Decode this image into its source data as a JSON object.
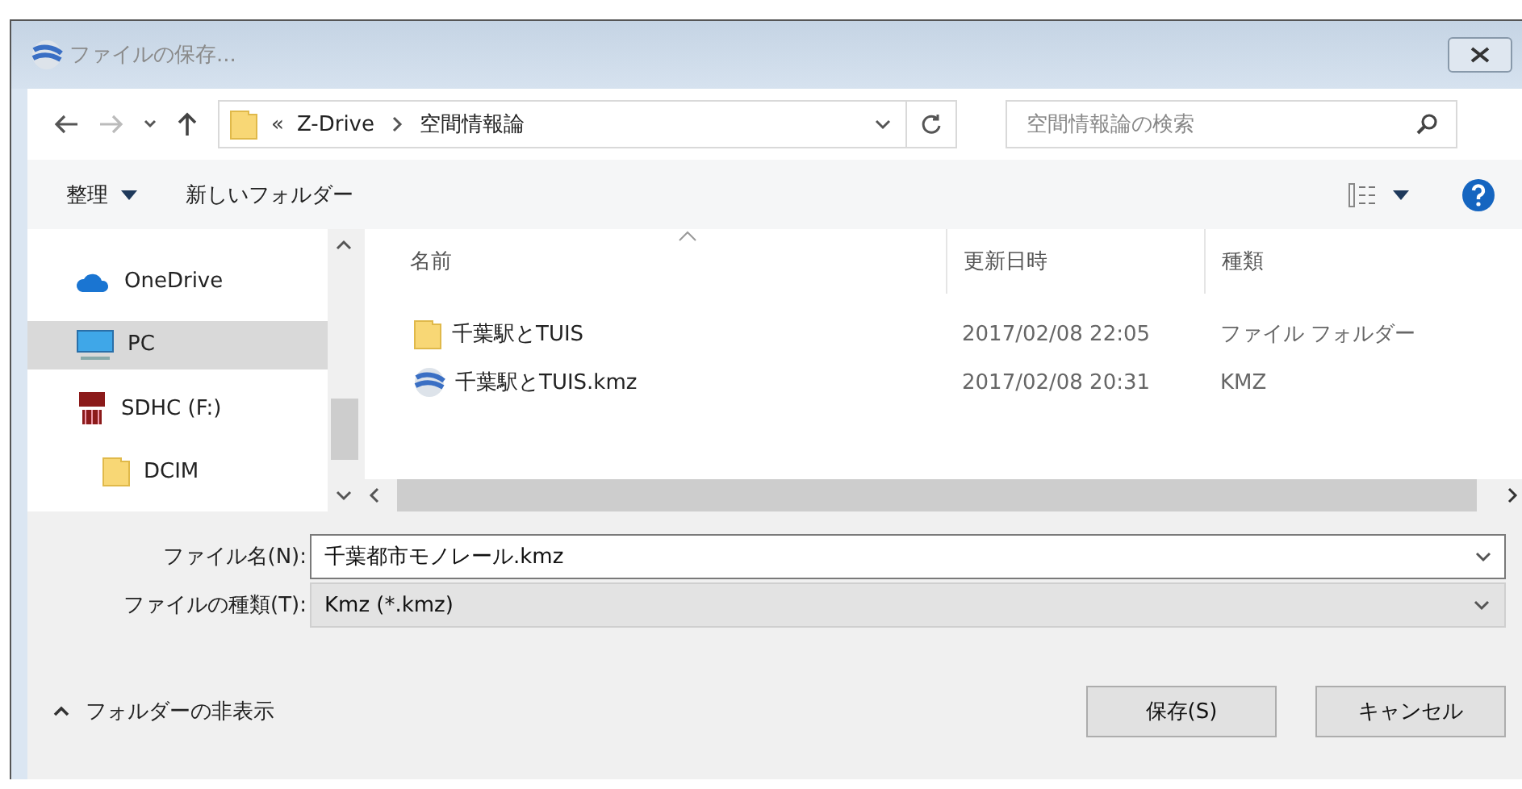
{
  "window": {
    "title": "ファイルの保存..."
  },
  "address": {
    "overflow": "«",
    "path": [
      "Z-Drive",
      "空間情報論"
    ]
  },
  "search": {
    "placeholder": "空間情報論の検索"
  },
  "toolbar": {
    "organize": "整理",
    "new_folder": "新しいフォルダー"
  },
  "sidebar": {
    "items": [
      {
        "label": "OneDrive",
        "kind": "cloud",
        "selected": false
      },
      {
        "label": "PC",
        "kind": "pc",
        "selected": true
      },
      {
        "label": "SDHC (F:)",
        "kind": "sd",
        "selected": false,
        "children": [
          {
            "label": "DCIM",
            "kind": "folder",
            "selected": false
          }
        ]
      }
    ]
  },
  "table": {
    "columns": [
      "名前",
      "更新日時",
      "種類"
    ],
    "rows": [
      {
        "kind": "folder",
        "name": "千葉駅とTUIS",
        "date": "2017/02/08 22:05",
        "type": "ファイル フォルダー"
      },
      {
        "kind": "kmz",
        "name": "千葉駅とTUIS.kmz",
        "date": "2017/02/08 20:31",
        "type": "KMZ"
      }
    ]
  },
  "filename": {
    "label": "ファイル名(N):",
    "value": "千葉都市モノレール.kmz"
  },
  "filetype": {
    "label": "ファイルの種類(T):",
    "value": "Kmz (*.kmz)"
  },
  "hide_folders": "フォルダーの非表示",
  "buttons": [
    "保存(S)",
    "キャンセル"
  ]
}
